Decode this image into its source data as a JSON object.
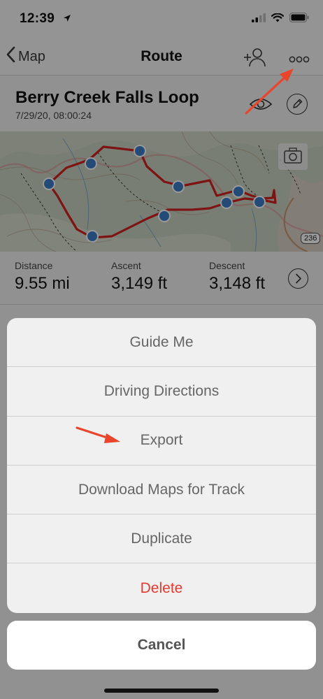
{
  "status_bar": {
    "time": "12:39"
  },
  "nav": {
    "back_label": "Map",
    "title": "Route"
  },
  "route": {
    "title": "Berry Creek Falls Loop",
    "date": "7/29/20, 08:00:24"
  },
  "map": {
    "road_badge": "236"
  },
  "stats": [
    {
      "label": "Distance",
      "value": "9.55 mi"
    },
    {
      "label": "Ascent",
      "value": "3,149 ft"
    },
    {
      "label": "Descent",
      "value": "3,148 ft"
    }
  ],
  "action_sheet": {
    "items": [
      {
        "label": "Guide Me"
      },
      {
        "label": "Driving Directions"
      },
      {
        "label": "Export"
      },
      {
        "label": "Download Maps for Track"
      },
      {
        "label": "Duplicate"
      },
      {
        "label": "Delete"
      }
    ],
    "cancel_label": "Cancel"
  },
  "colors": {
    "route_line": "#d02020",
    "waypoint": "#3d7cc9",
    "destructive": "#e53a2f",
    "annotation_arrow": "#e8452c"
  },
  "icons": [
    "location-arrow-icon",
    "signal-icon",
    "wifi-icon",
    "battery-icon",
    "chevron-left-icon",
    "add-person-icon",
    "more-icon",
    "eye-icon",
    "pencil-icon",
    "camera-icon",
    "chevron-right-icon"
  ]
}
